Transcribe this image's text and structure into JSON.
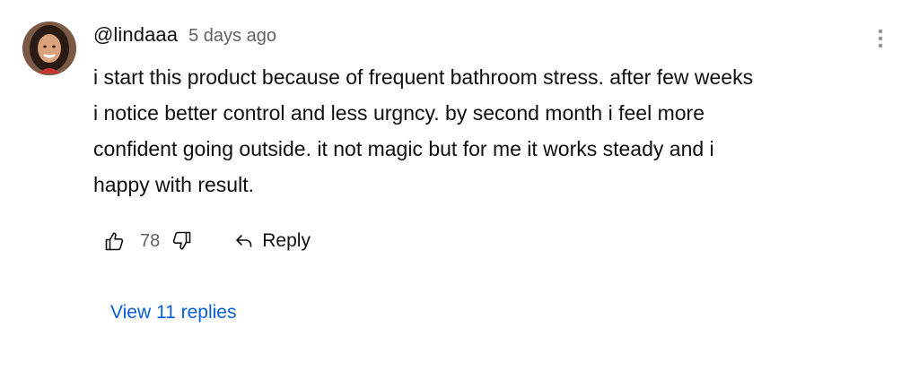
{
  "comment": {
    "author": "@lindaaa",
    "timestamp": "5 days ago",
    "text_lines": [
      "i start this product because of frequent bathroom stress. after few weeks",
      "i notice better control and less urgncy. by second month i feel more",
      "confident going outside. it not magic but for me it works steady and i",
      "happy with result."
    ],
    "like_count": "78",
    "reply_label": "Reply",
    "view_replies_label": "View 11 replies"
  },
  "icons": {
    "avatar": "avatar",
    "more": "more-vertical-icon",
    "like": "thumbs-up-icon",
    "dislike": "thumbs-down-icon",
    "reply": "reply-arrow-icon"
  },
  "colors": {
    "text_primary": "#0f0f0f",
    "text_secondary": "#606060",
    "link": "#065fd4"
  }
}
